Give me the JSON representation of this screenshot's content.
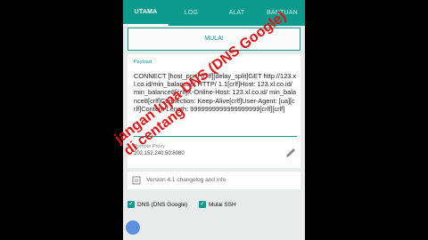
{
  "tabs": [
    {
      "label": "UTAMA"
    },
    {
      "label": "LOG"
    },
    {
      "label": "ALAT"
    },
    {
      "label": "BANTUAN"
    }
  ],
  "start_button": {
    "label": "MULAI"
  },
  "payload": {
    "label": "Payload",
    "value": "CONNECT [host_port] [crlf][delay_split]GET http://123.xl.co.id/min_balance8/ HTTP/ 1.1[crlf]Host: 123.xl.co.id/min_balance8[crlf]X-Online-Host: 123.xl.co.id/ min_balance8[crlf]Connection: Keep-Alive[crlf]User-Agent: [ua][crlf]Content-Length: 9999999999999999999[crlf][crlf]"
  },
  "proxy": {
    "label": "Remote Proxy",
    "value": "202.152.240.50:8080"
  },
  "changelog": {
    "text": "Version 4.1 changelog and info"
  },
  "options": {
    "dns": "DNS (DNS Google)",
    "ssh": "Mulai SSH"
  },
  "overlay": {
    "line1": "jangan lupa DNS (DNS Google)",
    "line2": "di centang"
  },
  "colors": {
    "accent": "#0b9a8c",
    "overlay": "#e01515"
  }
}
